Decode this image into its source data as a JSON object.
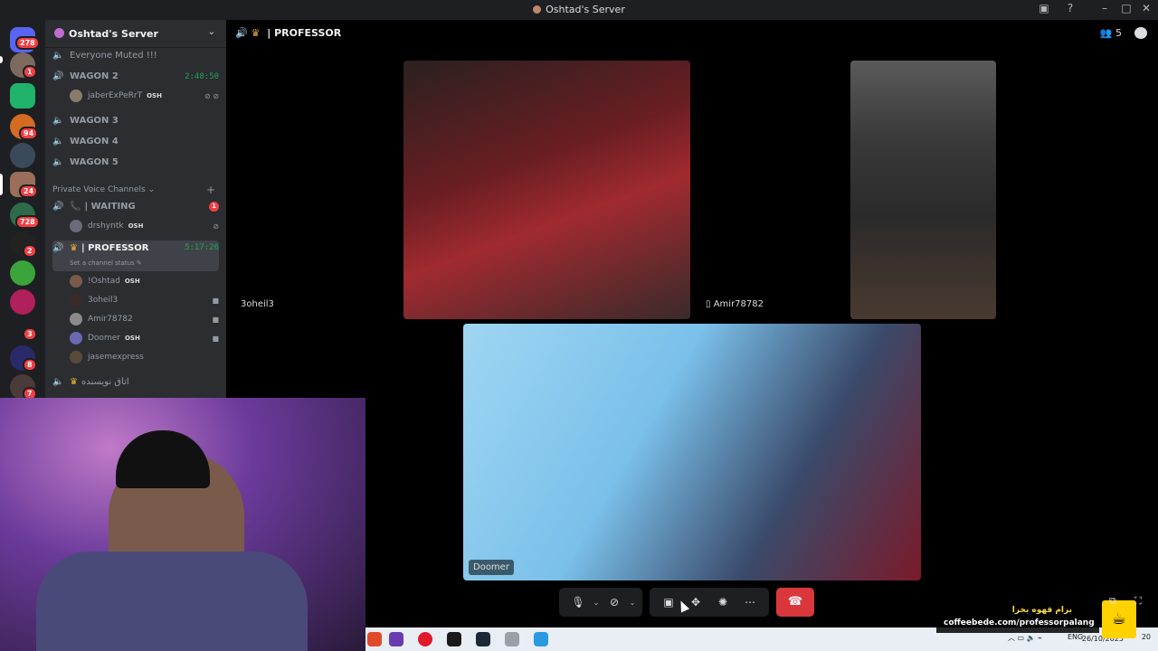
{
  "window": {
    "title": "Oshtad's Server"
  },
  "server_rail": {
    "badges": [
      "278",
      "1",
      "94",
      "24",
      "728",
      "2",
      "3",
      "8",
      "7"
    ]
  },
  "sidebar": {
    "server_name": "Oshtad's Server",
    "channels": [
      {
        "name": "Everyone Muted !!!",
        "type": "voice"
      },
      {
        "name": "WAGON 2",
        "type": "voice",
        "live": true,
        "time": "2:48:50"
      },
      {
        "name": "WAGON 3",
        "type": "voice"
      },
      {
        "name": "WAGON 4",
        "type": "voice"
      },
      {
        "name": "WAGON 5",
        "type": "voice"
      }
    ],
    "wagon2_user": {
      "name": "jaberExPeRrT",
      "tag": "OSH"
    },
    "category": "Private Voice Channels",
    "waiting": {
      "name": "| WAITING",
      "count": "1",
      "user": "drshyntk",
      "tag": "OSH"
    },
    "professor": {
      "name": "| PROFESSOR",
      "time": "5:17:26",
      "status": "Set a channel status",
      "members": [
        {
          "name": "!Oshtad",
          "tag": "OSH"
        },
        {
          "name": "3oheil3",
          "tag": ""
        },
        {
          "name": "Amir78782",
          "tag": ""
        },
        {
          "name": "Doomer",
          "tag": "OSH"
        },
        {
          "name": "jasemexpress",
          "tag": ""
        }
      ]
    },
    "last_channel": "اتاق نویسنده"
  },
  "stage": {
    "title": "| PROFESSOR",
    "participant_count": "5",
    "tiles": [
      {
        "name": "3oheil3"
      },
      {
        "name": "Amir78782"
      },
      {
        "name": "Doomer"
      }
    ]
  },
  "controls": {
    "buttons": [
      "mic-icon",
      "camera-off-icon",
      "screen-share-icon",
      "activities-icon",
      "soundboard-icon",
      "more-icon",
      "hangup-icon"
    ]
  },
  "overlay": {
    "promo_fa": "برام قهوه بخرا",
    "promo_url": "coffeebede.com/professorpalang"
  },
  "taskbar": {
    "lang": "ENG",
    "date": "26/10/2025",
    "notif_count": "20"
  },
  "colors": {
    "accent_green": "#23a559",
    "danger": "#da373c",
    "badge": "#f23f43",
    "sidebar_bg": "#2b2d31",
    "rail_bg": "#1e1f22"
  }
}
